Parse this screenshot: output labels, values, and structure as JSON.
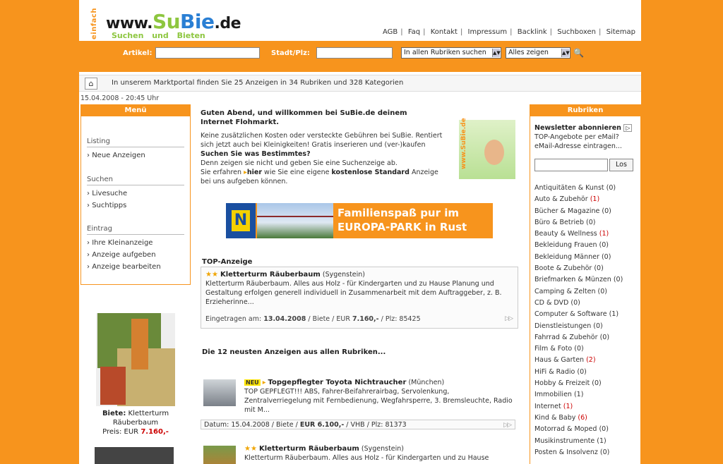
{
  "header": {
    "logo_vertical": "einfach",
    "logo_www": "www.",
    "logo_s": "S",
    "logo_u": "u",
    "logo_b": "Bie",
    "logo_de": ".de",
    "logo_sub": "Suchen und Bieten",
    "nav": [
      "AGB",
      "Faq",
      "Kontakt",
      "Impressum",
      "Backlink",
      "Suchboxen",
      "Sitemap"
    ]
  },
  "search": {
    "artikel_label": "Artikel:",
    "stadt_label": "Stadt/Plz:",
    "rubrik_select": "In allen Rubriken suchen",
    "filter_select": "Alles zeigen"
  },
  "info": {
    "text": "In unserem Marktportal finden Sie 25 Anzeigen in 34 Rubriken und 328 Kategorien",
    "datetime": "15.04.2008 - 20:45 Uhr"
  },
  "menu": {
    "title": "Menü",
    "sections": [
      {
        "title": "Listing",
        "items": [
          "Neue Anzeigen"
        ]
      },
      {
        "title": "Suchen",
        "items": [
          "Livesuche",
          "Suchtipps"
        ]
      },
      {
        "title": "Eintrag",
        "items": [
          "Ihre Kleinanzeige",
          "Anzeige aufgeben",
          "Anzeige bearbeiten"
        ]
      }
    ]
  },
  "promo": {
    "label": "Biete:",
    "title": "Kletterturm Räuberbaum",
    "price_label": "Preis: EUR",
    "price": "7.160,-"
  },
  "welcome": {
    "heading": "Guten Abend, und willkommen bei SuBie.de deinem Internet Flohmarkt.",
    "p1": "Keine zusätzlichen Kosten oder versteckte Gebühren bei SuBie. Rentiert sich jetzt auch bei Kleinigkeiten! Gratis inserieren und (ver-)kaufen",
    "p2_bold": "Suchen Sie was Bestimmtes?",
    "p3": "Denn zeigen sie nicht und geben Sie eine Suchenzeige ab.",
    "p4a": "Sie erfahren",
    "p4_link": "hier",
    "p4b": "wie Sie eine eigene",
    "p4_bold": "kostenlose Standard",
    "p4c": "Anzeige bei uns aufgeben können.",
    "img_text": "www.SuBie.de"
  },
  "banner": {
    "line1": "Familienspaß pur im",
    "line2": "EUROPA-PARK in Rust",
    "n_logo": "N"
  },
  "top_ad": {
    "label": "TOP-Anzeige",
    "title": "Kletterturm Räuberbaum",
    "location": "(Sygenstein)",
    "body": "Kletterturm Räuberbaum. Alles aus Holz - für Kindergarten und zu Hause Planung und Gestaltung erfolgen generell individuell in Zusammenarbeit mit dem Auftraggeber, z. B. Erzieherinne...",
    "meta_prefix": "Eingetragen am:",
    "date": "13.04.2008",
    "meta_mid": "/ Biete / EUR",
    "price": "7.160,-",
    "meta_end": "/ Plz: 85425"
  },
  "newest": {
    "heading": "Die 12 neusten Anzeigen aus allen Rubriken...",
    "items": [
      {
        "badge": "NEU",
        "title": "Topgepflegter Toyota Nichtraucher",
        "location": "(München)",
        "body": "TOP GEPFLEGT!!! ABS, Fahrer-Beifahrerairbag, Servolenkung, Zentralverriegelung mit Fernbedienung, Wegfahrsperre, 3. Bremsleuchte, Radio mit M...",
        "meta_a": "Datum: 15.04.2008 / Biete /",
        "price": "EUR 6.100,-",
        "meta_b": "/ VHB / Plz: 81373"
      },
      {
        "title": "Kletterturm Räuberbaum",
        "location": "(Sygenstein)",
        "body": "Kletterturm Räuberbaum. Alles aus Holz - für Kindergarten und zu Hause"
      }
    ]
  },
  "right": {
    "title": "Rubriken",
    "newsletter_heading": "Newsletter abonnieren",
    "newsletter_text": "TOP-Angebote per eMail? eMail-Adresse eintragen...",
    "newsletter_btn": "Los",
    "rubrics": [
      {
        "name": "Antiquitäten & Kunst",
        "count": "(0)"
      },
      {
        "name": "Auto & Zubehör",
        "count": "(1)",
        "red": true
      },
      {
        "name": "Bücher & Magazine",
        "count": "(0)"
      },
      {
        "name": "Büro & Betrieb",
        "count": "(0)"
      },
      {
        "name": "Beauty & Wellness",
        "count": "(1)",
        "red": true
      },
      {
        "name": "Bekleidung Frauen",
        "count": "(0)"
      },
      {
        "name": "Bekleidung Männer",
        "count": "(0)"
      },
      {
        "name": "Boote & Zubehör",
        "count": "(0)"
      },
      {
        "name": "Briefmarken & Münzen",
        "count": "(0)"
      },
      {
        "name": "Camping & Zelten",
        "count": "(0)"
      },
      {
        "name": "CD & DVD",
        "count": "(0)"
      },
      {
        "name": "Computer & Software",
        "count": "(1)"
      },
      {
        "name": "Dienstleistungen",
        "count": "(0)"
      },
      {
        "name": "Fahrrad & Zubehör",
        "count": "(0)"
      },
      {
        "name": "Film & Foto",
        "count": "(0)"
      },
      {
        "name": "Haus & Garten",
        "count": "(2)"
      },
      {
        "name": "HiFi & Radio",
        "count": "(0)"
      },
      {
        "name": "Hobby & Freizeit",
        "count": "(0)"
      },
      {
        "name": "Immobilien",
        "count": "(1)"
      },
      {
        "name": "Internet",
        "count": "(1)",
        "red": true
      },
      {
        "name": "Kind & Baby",
        "count": "(6)",
        "red": true
      },
      {
        "name": "Motorrad & Moped",
        "count": "(0)"
      },
      {
        "name": "Musikinstrumente",
        "count": "(1)"
      },
      {
        "name": "Posten & Insolvenz",
        "count": "(0)"
      }
    ]
  }
}
